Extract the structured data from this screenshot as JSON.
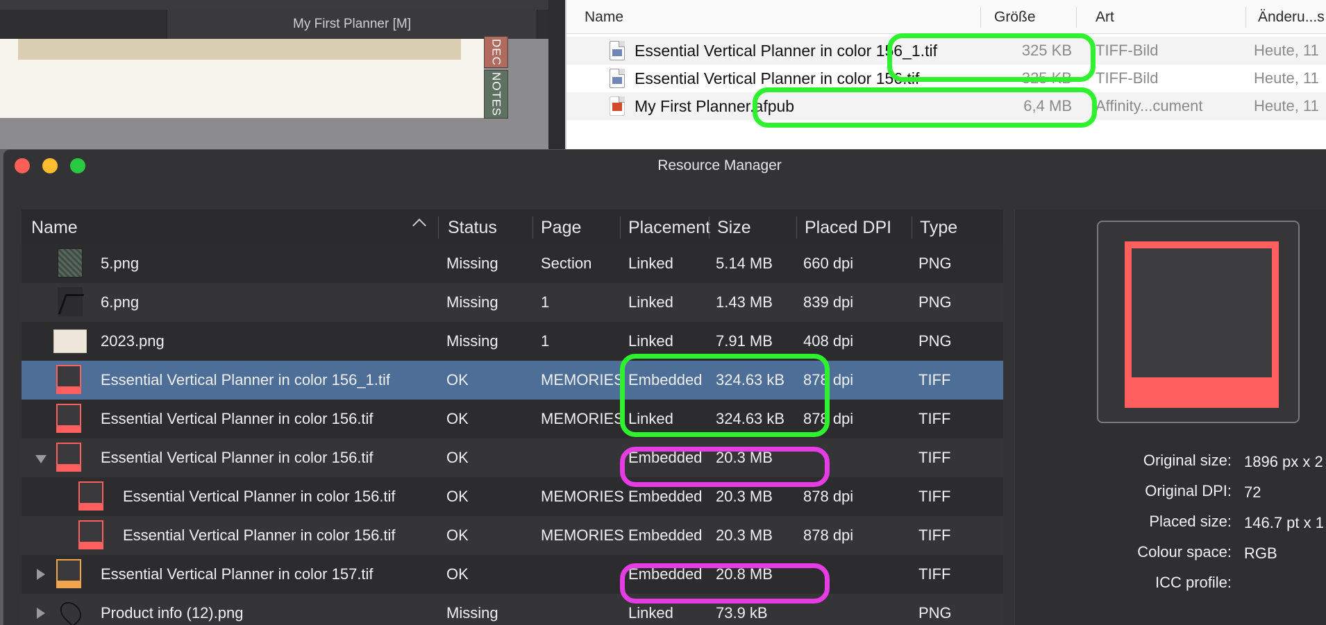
{
  "doc_window": {
    "tab_title": "My First Planner [M]",
    "side_tabs": [
      "DEC",
      "NOTES"
    ]
  },
  "finder": {
    "columns": {
      "name": "Name",
      "size": "Größe",
      "kind": "Art",
      "date": "Änderu...s"
    },
    "rows": [
      {
        "name": "Essential Vertical Planner in color 156_1.tif",
        "size": "325 KB",
        "kind": "TIFF-Bild",
        "date": "Heute, 11",
        "icon": "tiff-file-icon"
      },
      {
        "name": "Essential Vertical Planner in color 156.tif",
        "size": "325 KB",
        "kind": "TIFF-Bild",
        "date": "Heute, 11",
        "icon": "tiff-file-icon"
      },
      {
        "name": "My First Planner.afpub",
        "size": "6,4 MB",
        "kind": "Affinity...cument",
        "date": "Heute, 11",
        "icon": "afpub-file-icon"
      }
    ]
  },
  "resource_manager": {
    "title": "Resource Manager",
    "columns": {
      "name": "Name",
      "status": "Status",
      "page": "Page",
      "placement": "Placement",
      "size": "Size",
      "dpi": "Placed DPI",
      "type": "Type"
    },
    "rows": [
      {
        "name": "5.png",
        "status": "Missing",
        "page": "Section",
        "placement": "Linked",
        "size": "5.14 MB",
        "dpi": "660 dpi",
        "type": "PNG"
      },
      {
        "name": "6.png",
        "status": "Missing",
        "page": "1",
        "placement": "Linked",
        "size": "1.43 MB",
        "dpi": "839 dpi",
        "type": "PNG"
      },
      {
        "name": "2023.png",
        "status": "Missing",
        "page": "1",
        "placement": "Linked",
        "size": "7.91 MB",
        "dpi": "408 dpi",
        "type": "PNG"
      },
      {
        "name": "Essential Vertical Planner in color 156_1.tif",
        "status": "OK",
        "page": "MEMORIES",
        "placement": "Embedded",
        "size": "324.63 kB",
        "dpi": "878 dpi",
        "type": "TIFF"
      },
      {
        "name": "Essential Vertical Planner in color 156.tif",
        "status": "OK",
        "page": "MEMORIES",
        "placement": "Linked",
        "size": "324.63 kB",
        "dpi": "878 dpi",
        "type": "TIFF"
      },
      {
        "name": "Essential Vertical Planner in color 156.tif",
        "status": "OK",
        "page": "",
        "placement": "Embedded",
        "size": "20.3 MB",
        "dpi": "",
        "type": "TIFF"
      },
      {
        "name": "Essential Vertical Planner in color 156.tif",
        "status": "OK",
        "page": "MEMORIES",
        "placement": "Embedded",
        "size": "20.3 MB",
        "dpi": "878 dpi",
        "type": "TIFF"
      },
      {
        "name": "Essential Vertical Planner in color 156.tif",
        "status": "OK",
        "page": "MEMORIES",
        "placement": "Embedded",
        "size": "20.3 MB",
        "dpi": "878 dpi",
        "type": "TIFF"
      },
      {
        "name": "Essential Vertical Planner in color 157.tif",
        "status": "OK",
        "page": "",
        "placement": "Embedded",
        "size": "20.8 MB",
        "dpi": "",
        "type": "TIFF"
      },
      {
        "name": "Product info (12).png",
        "status": "Missing",
        "page": "",
        "placement": "Linked",
        "size": "73.9 kB",
        "dpi": "",
        "type": "PNG"
      }
    ],
    "info_panel": {
      "labels": {
        "original_size": "Original size:",
        "original_dpi": "Original DPI:",
        "placed_size": "Placed size:",
        "colour_space": "Colour space:",
        "icc_profile": "ICC profile:"
      },
      "values": {
        "original_size": "1896 px x 2",
        "original_dpi": "72",
        "placed_size": "146.7 pt x 1",
        "colour_space": "RGB",
        "icc_profile": ""
      }
    }
  },
  "colors": {
    "selection": "#4d6e97",
    "tiff_thumb": "#ff5f5f",
    "highlight_green": "#2df22d",
    "highlight_magenta": "#e53ce3"
  }
}
